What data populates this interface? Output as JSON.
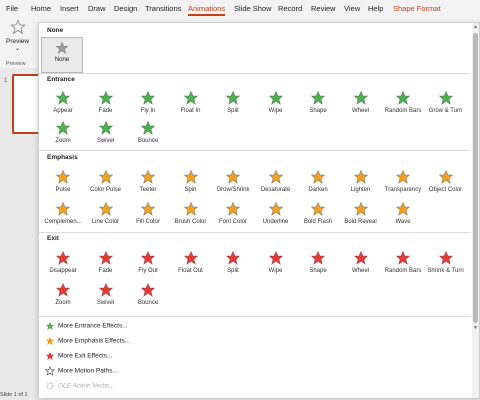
{
  "tabs": [
    "File",
    "Home",
    "Insert",
    "Draw",
    "Design",
    "Transitions",
    "Animations",
    "Slide Show",
    "Record",
    "Review",
    "View",
    "Help",
    "Shape Format"
  ],
  "preview": {
    "label": "Preview",
    "group": "Preview"
  },
  "slide_number": "1",
  "status": "Slide 1 of 1",
  "gallery": {
    "none_header": "None",
    "none_label": "None",
    "entrance_header": "Entrance",
    "entrance": [
      "Appear",
      "Fade",
      "Fly In",
      "Float In",
      "Split",
      "Wipe",
      "Shape",
      "Wheel",
      "Random Bars",
      "Grow & Turn",
      "Zoom",
      "Swivel",
      "Bounce"
    ],
    "emphasis_header": "Emphasis",
    "emphasis": [
      "Pulse",
      "Color Pulse",
      "Teeter",
      "Spin",
      "Grow/Shrink",
      "Desaturate",
      "Darken",
      "Lighten",
      "Transparency",
      "Object Color",
      "Complemen...",
      "Line Color",
      "Fill Color",
      "Brush Color",
      "Font Color",
      "Underline",
      "Bold Flash",
      "Bold Reveal",
      "Wave"
    ],
    "exit_header": "Exit",
    "exit": [
      "Disappear",
      "Fade",
      "Fly Out",
      "Float Out",
      "Split",
      "Wipe",
      "Shape",
      "Wheel",
      "Random Bars",
      "Shrink & Turn",
      "Zoom",
      "Swivel",
      "Bounce"
    ],
    "more": [
      "More Entrance Effects...",
      "More Emphasis Effects...",
      "More Exit Effects...",
      "More Motion Paths...",
      "OLE Action Verbs..."
    ]
  },
  "colors": {
    "entrance": "#4caf50",
    "emphasis": "#f0a020",
    "exit": "#e53935",
    "accent": "#c43e1c"
  }
}
